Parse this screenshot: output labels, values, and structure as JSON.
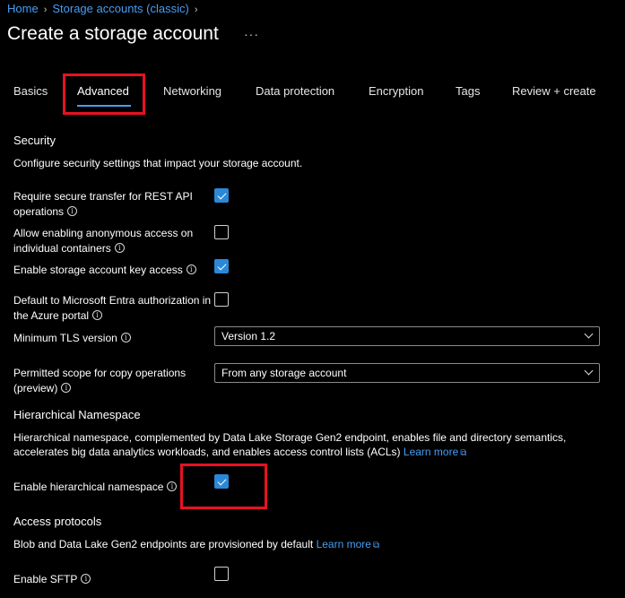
{
  "breadcrumb": {
    "home": "Home",
    "storage": "Storage accounts (classic)"
  },
  "page": {
    "title": "Create a storage account",
    "more": "···"
  },
  "tabs": [
    "Basics",
    "Advanced",
    "Networking",
    "Data protection",
    "Encryption",
    "Tags",
    "Review + create"
  ],
  "security": {
    "title": "Security",
    "description": "Configure security settings that impact your storage account.",
    "secure_transfer": {
      "label1": "Require secure transfer for REST API",
      "label2": "operations",
      "checked": true
    },
    "anonymous_access": {
      "label1": "Allow enabling anonymous access on",
      "label2": "individual containers",
      "checked": false
    },
    "key_access": {
      "label": "Enable storage account key access",
      "checked": true
    },
    "entra_auth": {
      "label1": "Default to Microsoft Entra authorization in",
      "label2": "the Azure portal",
      "checked": false
    },
    "tls": {
      "label": "Minimum TLS version",
      "value": "Version 1.2"
    },
    "copy_scope": {
      "label1": "Permitted scope for copy operations",
      "label2": "(preview)",
      "value": "From any storage account"
    }
  },
  "hns": {
    "title": "Hierarchical Namespace",
    "desc1": "Hierarchical namespace, complemented by Data Lake Storage Gen2 endpoint, enables file and directory semantics,",
    "desc2": "accelerates big data analytics workloads, and enables access control lists (ACLs)",
    "learn_more": "Learn more",
    "enable": {
      "label": "Enable hierarchical namespace",
      "checked": true
    }
  },
  "protocols": {
    "title": "Access protocols",
    "desc": "Blob and Data Lake Gen2 endpoints are provisioned by default",
    "learn_more": "Learn more",
    "sftp": {
      "label": "Enable SFTP",
      "checked": false
    }
  },
  "icons": {
    "chevron_right": "›",
    "info": "i",
    "external": "⧉"
  },
  "colors": {
    "accent": "#479ef5",
    "highlight": "#e81123",
    "checkbox": "#2b88d8"
  }
}
